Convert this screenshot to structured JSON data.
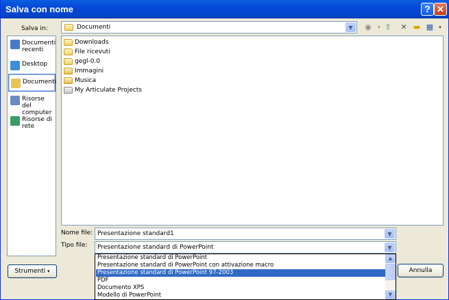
{
  "window": {
    "title": "Salva con nome",
    "help_label": "?",
    "close_label": "✕"
  },
  "save_in": {
    "label": "Salva in:",
    "value": "Documenti"
  },
  "places": [
    {
      "label": "Documenti recenti",
      "icon": "recent-docs-icon",
      "color": "#4a7ac7"
    },
    {
      "label": "Desktop",
      "icon": "desktop-icon",
      "color": "#3c8fd8"
    },
    {
      "label": "Documenti",
      "icon": "my-documents-icon",
      "color": "#e8c451"
    },
    {
      "label": "Risorse del computer",
      "icon": "my-computer-icon",
      "color": "#6b8cc2"
    },
    {
      "label": "Risorse di rete",
      "icon": "network-icon",
      "color": "#3a9c6a"
    }
  ],
  "files": [
    {
      "name": "Downloads",
      "icon": "folder-icon"
    },
    {
      "name": "File ricevuti",
      "icon": "folder-icon"
    },
    {
      "name": "gegl-0.0",
      "icon": "folder-icon"
    },
    {
      "name": "Immagini",
      "icon": "folder-icon"
    },
    {
      "name": "Musica",
      "icon": "folder-icon"
    },
    {
      "name": "My Articulate Projects",
      "icon": "special-folder-icon"
    }
  ],
  "filename": {
    "label": "Nome file:",
    "value": "Presentazione standard1"
  },
  "filetype": {
    "label": "Tipo file:",
    "value": "Presentazione standard di PowerPoint",
    "options": [
      "Presentazione standard di PowerPoint",
      "Presentazione standard di PowerPoint con attivazione macro",
      "Presentazione standard di PowerPoint 97-2003",
      "PDF",
      "Documento XPS",
      "Modello di PowerPoint"
    ],
    "selected_index": 2
  },
  "buttons": {
    "tools": "Strumenti",
    "cancel": "Annulla"
  },
  "colors": {
    "titlebar": "#0548d8",
    "selection": "#316ac5",
    "dialog_bg": "#ece9d8"
  }
}
